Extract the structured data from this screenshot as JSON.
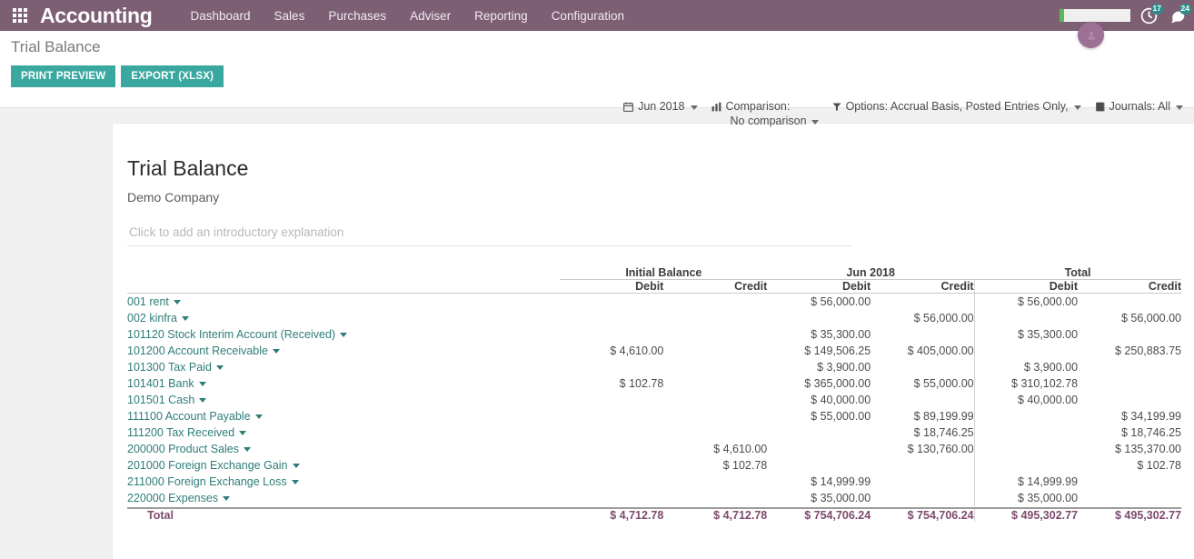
{
  "topbar": {
    "apps_icon": "apps-grid-icon",
    "brand": "Accounting",
    "menu": [
      {
        "label": "Dashboard"
      },
      {
        "label": "Sales"
      },
      {
        "label": "Purchases"
      },
      {
        "label": "Adviser"
      },
      {
        "label": "Reporting"
      },
      {
        "label": "Configuration"
      }
    ],
    "search_placeholder": "",
    "activity_icon": "clock-activity-icon",
    "activity_badge": "17",
    "messages_icon": "chat-messages-icon",
    "messages_badge": "24",
    "avatar_icon": "user-avatar",
    "brand_color": "#7d5f74",
    "badge_color": "#2e8c8c"
  },
  "control_panel": {
    "breadcrumb": "Trial Balance",
    "print_preview_label": "PRINT PREVIEW",
    "export_label": "EXPORT (XLSX)",
    "accent_color": "#3aa8a0",
    "filters": {
      "date_icon": "calendar-icon",
      "date_label": "Jun 2018",
      "comparison_icon": "bar-chart-icon",
      "comparison_label": "Comparison:",
      "comparison_value": "No comparison",
      "options_icon": "filter-funnel-icon",
      "options_label": "Options: Accrual Basis, Posted Entries Only,",
      "journals_icon": "book-icon",
      "journals_label": "Journals: All"
    }
  },
  "report": {
    "title": "Trial Balance",
    "company": "Demo Company",
    "intro_placeholder": "Click to add an introductory explanation",
    "intro_value": "",
    "column_groups": [
      {
        "label": "Initial Balance"
      },
      {
        "label": "Jun 2018"
      },
      {
        "label": "Total"
      }
    ],
    "sub_columns": [
      "Debit",
      "Credit",
      "Debit",
      "Credit",
      "Debit",
      "Credit"
    ],
    "rows": [
      {
        "account": "001 rent",
        "initial_debit": "",
        "initial_credit": "",
        "period_debit": "$ 56,000.00",
        "period_credit": "",
        "total_debit": "$ 56,000.00",
        "total_credit": ""
      },
      {
        "account": "002 kinfra",
        "initial_debit": "",
        "initial_credit": "",
        "period_debit": "",
        "period_credit": "$ 56,000.00",
        "total_debit": "",
        "total_credit": "$ 56,000.00"
      },
      {
        "account": "101120 Stock Interim Account (Received)",
        "initial_debit": "",
        "initial_credit": "",
        "period_debit": "$ 35,300.00",
        "period_credit": "",
        "total_debit": "$ 35,300.00",
        "total_credit": ""
      },
      {
        "account": "101200 Account Receivable",
        "initial_debit": "$ 4,610.00",
        "initial_credit": "",
        "period_debit": "$ 149,506.25",
        "period_credit": "$ 405,000.00",
        "total_debit": "",
        "total_credit": "$ 250,883.75"
      },
      {
        "account": "101300 Tax Paid",
        "initial_debit": "",
        "initial_credit": "",
        "period_debit": "$ 3,900.00",
        "period_credit": "",
        "total_debit": "$ 3,900.00",
        "total_credit": ""
      },
      {
        "account": "101401 Bank",
        "initial_debit": "$ 102.78",
        "initial_credit": "",
        "period_debit": "$ 365,000.00",
        "period_credit": "$ 55,000.00",
        "total_debit": "$ 310,102.78",
        "total_credit": ""
      },
      {
        "account": "101501 Cash",
        "initial_debit": "",
        "initial_credit": "",
        "period_debit": "$ 40,000.00",
        "period_credit": "",
        "total_debit": "$ 40,000.00",
        "total_credit": ""
      },
      {
        "account": "111100 Account Payable",
        "initial_debit": "",
        "initial_credit": "",
        "period_debit": "$ 55,000.00",
        "period_credit": "$ 89,199.99",
        "total_debit": "",
        "total_credit": "$ 34,199.99"
      },
      {
        "account": "111200 Tax Received",
        "initial_debit": "",
        "initial_credit": "",
        "period_debit": "",
        "period_credit": "$ 18,746.25",
        "total_debit": "",
        "total_credit": "$ 18,746.25"
      },
      {
        "account": "200000 Product Sales",
        "initial_debit": "",
        "initial_credit": "$ 4,610.00",
        "period_debit": "",
        "period_credit": "$ 130,760.00",
        "total_debit": "",
        "total_credit": "$ 135,370.00"
      },
      {
        "account": "201000 Foreign Exchange Gain",
        "initial_debit": "",
        "initial_credit": "$ 102.78",
        "period_debit": "",
        "period_credit": "",
        "total_debit": "",
        "total_credit": "$ 102.78"
      },
      {
        "account": "211000 Foreign Exchange Loss",
        "initial_debit": "",
        "initial_credit": "",
        "period_debit": "$ 14,999.99",
        "period_credit": "",
        "total_debit": "$ 14,999.99",
        "total_credit": ""
      },
      {
        "account": "220000 Expenses",
        "initial_debit": "",
        "initial_credit": "",
        "period_debit": "$ 35,000.00",
        "period_credit": "",
        "total_debit": "$ 35,000.00",
        "total_credit": ""
      }
    ],
    "total_row": {
      "label": "Total",
      "initial_debit": "$ 4,712.78",
      "initial_credit": "$ 4,712.78",
      "period_debit": "$ 754,706.24",
      "period_credit": "$ 754,706.24",
      "total_debit": "$ 495,302.77",
      "total_credit": "$ 495,302.77"
    },
    "link_color": "#2e7d78",
    "total_color": "#7d4a6e"
  }
}
